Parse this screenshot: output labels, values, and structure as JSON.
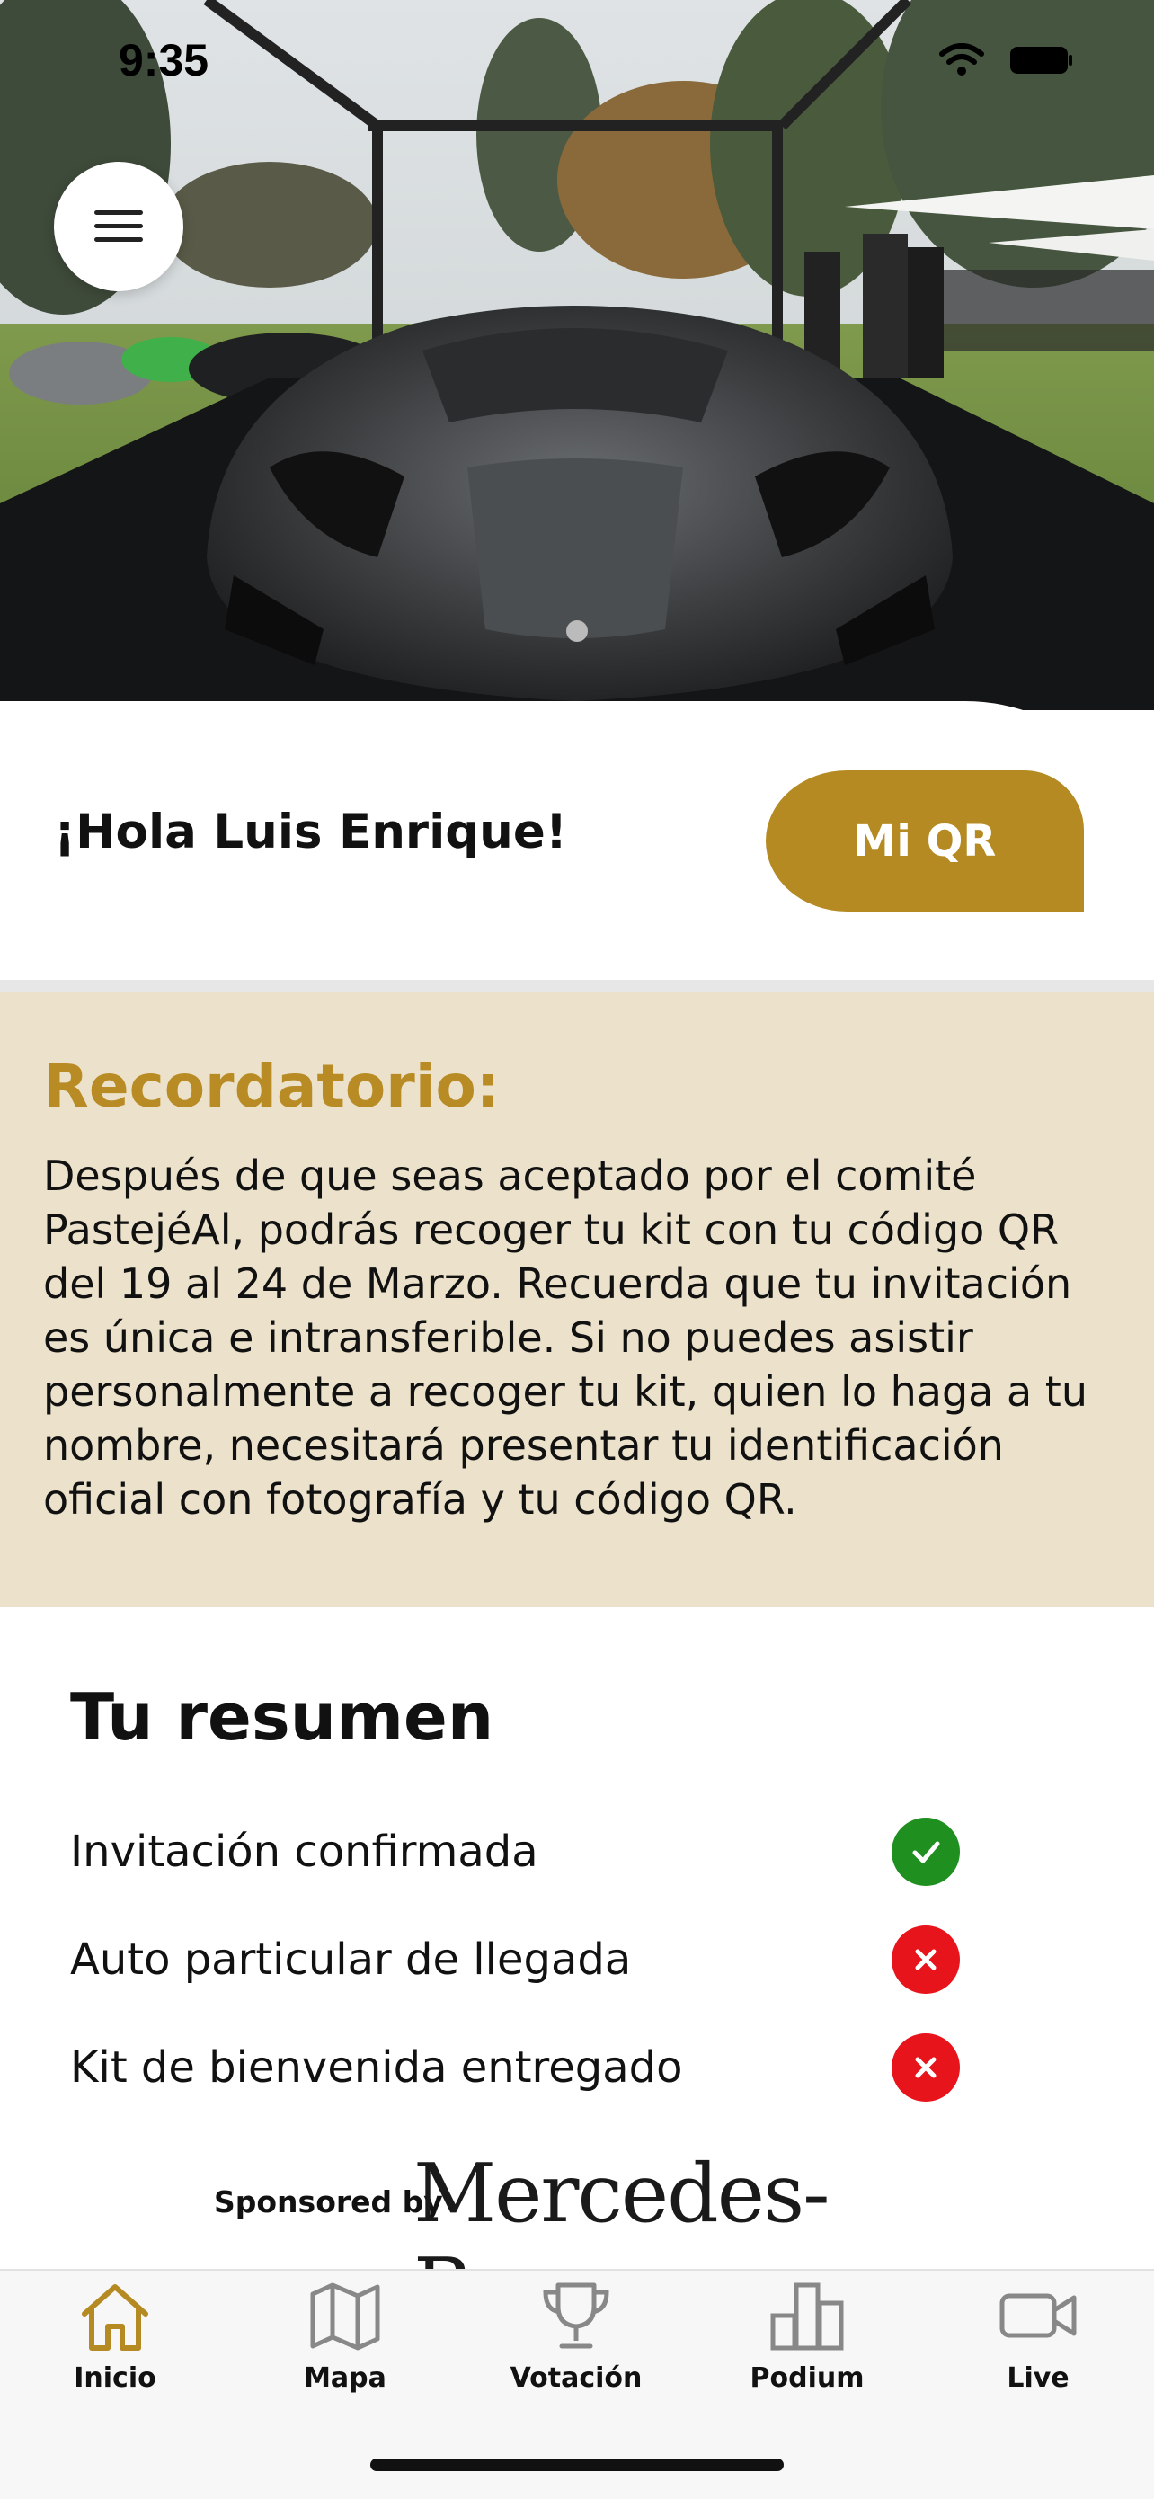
{
  "status_bar": {
    "time": "9:35"
  },
  "greeting": "¡Hola Luis Enrique!",
  "qr_button_label": "Mi QR",
  "reminder": {
    "title": "Recordatorio:",
    "body": "Después de que seas aceptado por el comité PastejéAl, podrás recoger tu kit con tu código QR del 19 al 24 de Marzo. Recuerda que tu invitación es única e intransferible. Si no puedes asistir personalmente a recoger tu kit, quien lo haga a tu nombre, necesitará presentar tu identificación oficial con fotografía y tu código QR."
  },
  "summary": {
    "title": "Tu resumen",
    "items": [
      {
        "label": "Invitación confirmada",
        "status": "done"
      },
      {
        "label": "Auto particular de llegada",
        "status": "pending"
      },
      {
        "label": "Kit de bienvenida entregado",
        "status": "pending"
      }
    ]
  },
  "sponsor": {
    "label": "Sponsored by",
    "brand": "Mercedes-Benz"
  },
  "tabs": [
    {
      "label": "Inicio",
      "icon": "home-icon",
      "active": true
    },
    {
      "label": "Mapa",
      "icon": "map-icon",
      "active": false
    },
    {
      "label": "Votación",
      "icon": "trophy-icon",
      "active": false
    },
    {
      "label": "Podium",
      "icon": "podium-icon",
      "active": false
    },
    {
      "label": "Live",
      "icon": "video-icon",
      "active": false
    }
  ],
  "colors": {
    "accent": "#b58a22",
    "reminder_bg": "#ece2cb",
    "done": "#1f8f1f",
    "pending": "#e8141b"
  }
}
